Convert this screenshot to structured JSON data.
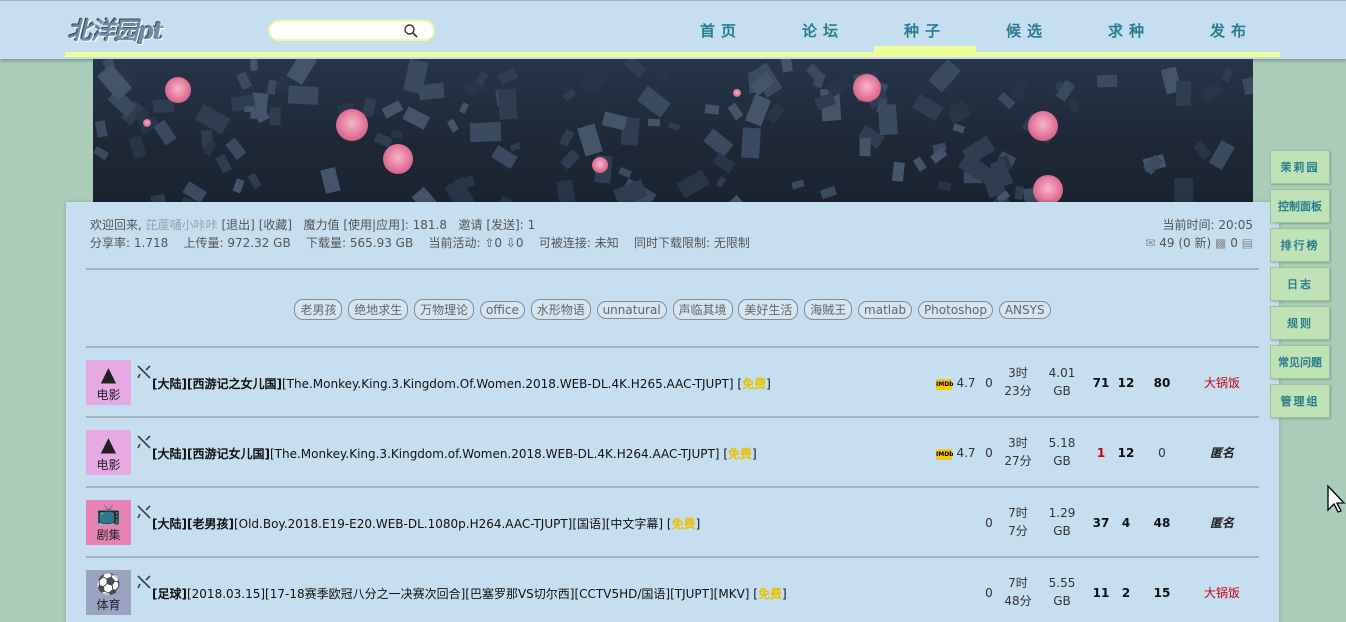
{
  "header": {
    "logo": "北洋园pt",
    "search_placeholder": "",
    "nav": [
      {
        "label": "首页",
        "active": false
      },
      {
        "label": "论坛",
        "active": false
      },
      {
        "label": "种子",
        "active": true
      },
      {
        "label": "候选",
        "active": false
      },
      {
        "label": "求种",
        "active": false
      },
      {
        "label": "发布",
        "active": false
      }
    ]
  },
  "user": {
    "welcome": "欢迎回来,",
    "username": "芘蓙嗵小咔咔",
    "logout": "[退出]",
    "favorites": "[收藏]",
    "bonus_label": "魔力值",
    "bonus_use": "[使用|应用]:",
    "bonus_value": "181.8",
    "invite_label": "邀请",
    "invite_send": "[发送]:",
    "invite_value": "1",
    "ratio_label": "分享率:",
    "ratio_value": "1.718",
    "upload_label": "上传量:",
    "upload_value": "972.32 GB",
    "download_label": "下载量:",
    "download_value": "565.93 GB",
    "active_label": "当前活动:",
    "active_value": "⇧0 ⇩0",
    "connectable_label": "可被连接:",
    "connectable_value": "未知",
    "limit_label": "同时下载限制:",
    "limit_value": "无限制",
    "time_label": "当前时间:",
    "time_value": "20:05",
    "messages": "49 (0 新)",
    "friends": "0"
  },
  "tags": [
    "老男孩",
    "绝地求生",
    "万物理论",
    "office",
    "水形物语",
    "unnatural",
    "声临其境",
    "美好生活",
    "海贼王",
    "matlab",
    "Photoshop",
    "ANSYS"
  ],
  "torrents": [
    {
      "category": "电影",
      "cat_icon": "hat-icon",
      "title_prefix": "[大陆]",
      "title_bold": "[西游记之女儿国]",
      "title_rest": "[The.Monkey.King.3.Kingdom.Of.Women.2018.WEB-DL.4K.H265.AAC-TJUPT]",
      "free": "免费",
      "imdb": "4.7",
      "comments": "0",
      "age_1": "3时",
      "age_2": "23分",
      "size_1": "4.01",
      "size_2": "GB",
      "seeders": "71",
      "leechers": "12",
      "completed": "80",
      "uploader": "大锅饭"
    },
    {
      "category": "电影",
      "cat_icon": "hat-icon",
      "title_prefix": "[大陆]",
      "title_bold": "[西游记女儿国]",
      "title_rest": "[The.Monkey.King.3.Kingdom.of.Women.2018.WEB-DL.4K.H264.AAC-TJUPT]",
      "free": "免费",
      "imdb": "4.7",
      "comments": "0",
      "age_1": "3时",
      "age_2": "27分",
      "size_1": "5.18",
      "size_2": "GB",
      "seeders": "1",
      "leechers": "12",
      "completed": "0",
      "uploader": "匿名"
    },
    {
      "category": "剧集",
      "cat_icon": "tv-icon",
      "title_prefix": "[大陆]",
      "title_bold": "[老男孩]",
      "title_rest": "[Old.Boy.2018.E19-E20.WEB-DL.1080p.H264.AAC-TJUPT][国语][中文字幕]",
      "free": "免费",
      "imdb": "",
      "comments": "0",
      "age_1": "7时",
      "age_2": "7分",
      "size_1": "1.29",
      "size_2": "GB",
      "seeders": "37",
      "leechers": "4",
      "completed": "48",
      "uploader": "匿名"
    },
    {
      "category": "体育",
      "cat_icon": "soccer-ball-icon",
      "title_prefix": "[足球]",
      "title_bold": "",
      "title_rest": "[2018.03.15][17-18赛季欧冠八分之一决赛次回合][巴塞罗那VS切尔西][CCTV5HD/国语][TJUPT][MKV]",
      "free": "免费",
      "imdb": "",
      "comments": "0",
      "age_1": "7时",
      "age_2": "48分",
      "size_1": "5.55",
      "size_2": "GB",
      "seeders": "11",
      "leechers": "2",
      "completed": "15",
      "uploader": "大锅饭"
    }
  ],
  "sidemenu": [
    "茉莉园",
    "控制面板",
    "排行榜",
    "日志",
    "规则",
    "常见问题",
    "管理组"
  ]
}
